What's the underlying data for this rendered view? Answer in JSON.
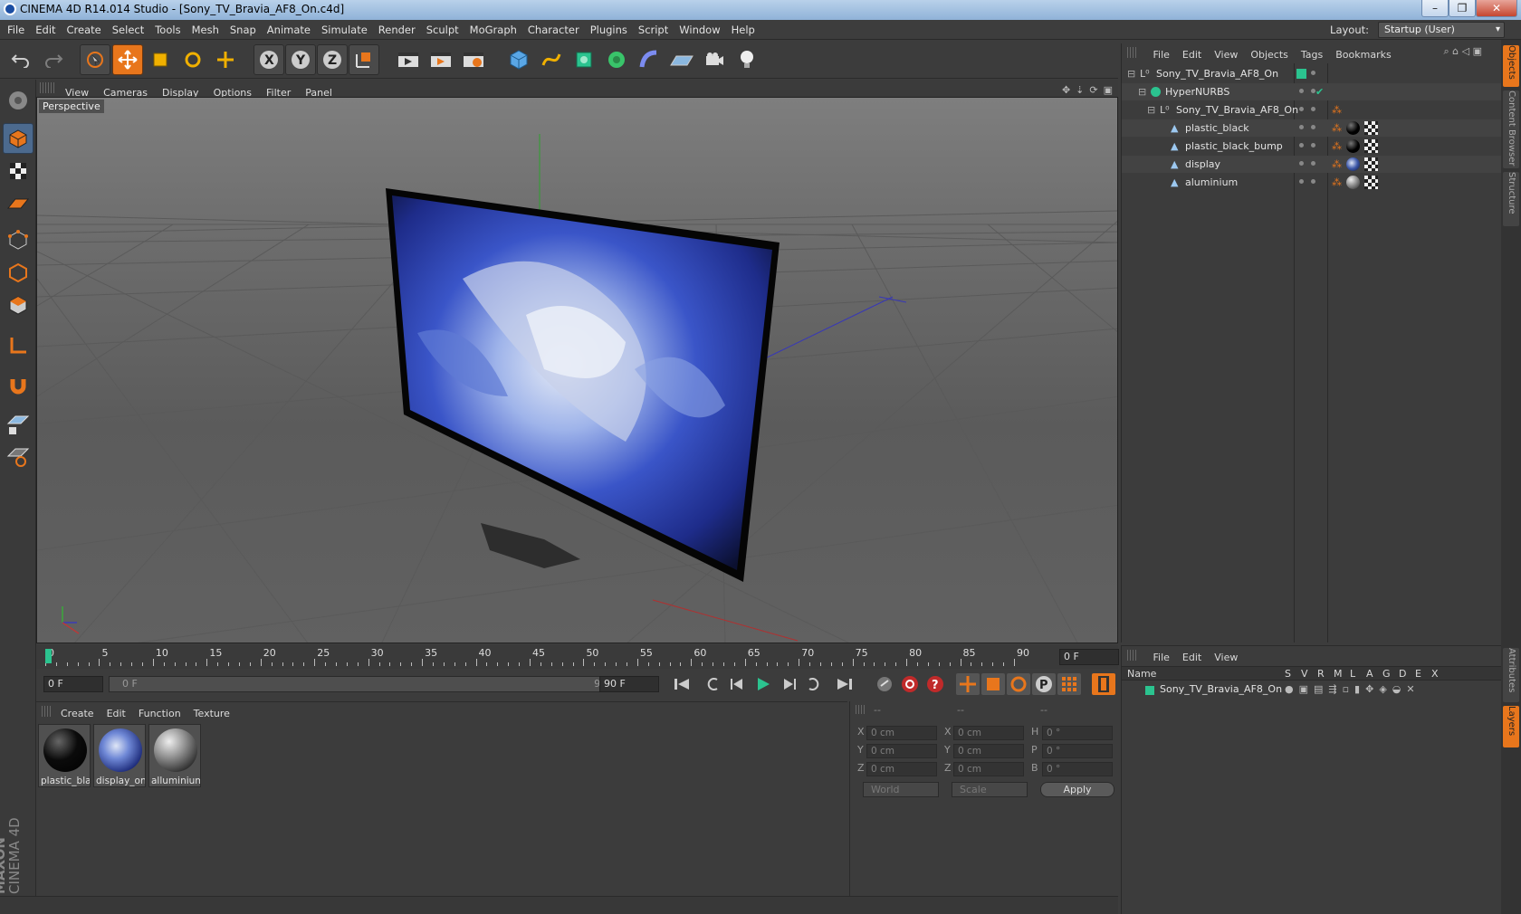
{
  "window": {
    "title": "CINEMA 4D R14.014 Studio - [Sony_TV_Bravia_AF8_On.c4d]",
    "min": "–",
    "max": "❐",
    "close": "✕"
  },
  "menu": [
    "File",
    "Edit",
    "Create",
    "Select",
    "Tools",
    "Mesh",
    "Snap",
    "Animate",
    "Simulate",
    "Render",
    "Sculpt",
    "MoGraph",
    "Character",
    "Plugins",
    "Script",
    "Window",
    "Help"
  ],
  "layout": {
    "label": "Layout:",
    "value": "Startup (User)"
  },
  "viewport": {
    "menu": [
      "View",
      "Cameras",
      "Display",
      "Options",
      "Filter",
      "Panel"
    ],
    "label": "Perspective"
  },
  "timeline": {
    "ticks": [
      "0",
      "5",
      "10",
      "15",
      "20",
      "25",
      "30",
      "35",
      "40",
      "45",
      "50",
      "55",
      "60",
      "65",
      "70",
      "75",
      "80",
      "85",
      "90"
    ],
    "current": "0 F"
  },
  "playback": {
    "start": "0 F",
    "slider_start": "0 F",
    "slider_end": "90 F",
    "end": "90 F"
  },
  "materials": {
    "menu": [
      "Create",
      "Edit",
      "Function",
      "Texture"
    ],
    "items": [
      {
        "name": "plastic_bla",
        "color": "#0b0b0b"
      },
      {
        "name": "display_on",
        "color": "#3c57a8"
      },
      {
        "name": "alluminium",
        "color": "#9a9a9a"
      }
    ]
  },
  "coords": {
    "headers": [
      "--",
      "--",
      "--"
    ],
    "rows": [
      {
        "a": "X",
        "av": "0 cm",
        "b": "X",
        "bv": "0 cm",
        "c": "H",
        "cv": "0 °"
      },
      {
        "a": "Y",
        "av": "0 cm",
        "b": "Y",
        "bv": "0 cm",
        "c": "P",
        "cv": "0 °"
      },
      {
        "a": "Z",
        "av": "0 cm",
        "b": "Z",
        "bv": "0 cm",
        "c": "B",
        "cv": "0 °"
      }
    ],
    "world": "World",
    "scale": "Scale",
    "apply": "Apply"
  },
  "objects": {
    "menu": [
      "File",
      "Edit",
      "View",
      "Objects",
      "Tags",
      "Bookmarks"
    ],
    "tree": [
      {
        "name": "Sony_TV_Bravia_AF8_On"
      },
      {
        "name": "HyperNURBS"
      },
      {
        "name": "Sony_TV_Bravia_AF8_On"
      },
      {
        "name": "plastic_black"
      },
      {
        "name": "plastic_black_bump"
      },
      {
        "name": "display"
      },
      {
        "name": "aluminium"
      }
    ]
  },
  "attributes": {
    "menu": [
      "File",
      "Edit",
      "View"
    ],
    "columns": [
      "Name",
      "S",
      "V",
      "R",
      "M",
      "L",
      "A",
      "G",
      "D",
      "E",
      "X"
    ],
    "row": "Sony_TV_Bravia_AF8_On"
  },
  "side_tabs": [
    "Objects",
    "Content Browser",
    "Structure",
    "Attributes",
    "Layers"
  ],
  "brand": {
    "line1": "MAXON",
    "line2": "CINEMA 4D"
  },
  "colors": {
    "accent": "#e8761c",
    "selection": "#4c6a8e",
    "green": "#2bc38f"
  }
}
